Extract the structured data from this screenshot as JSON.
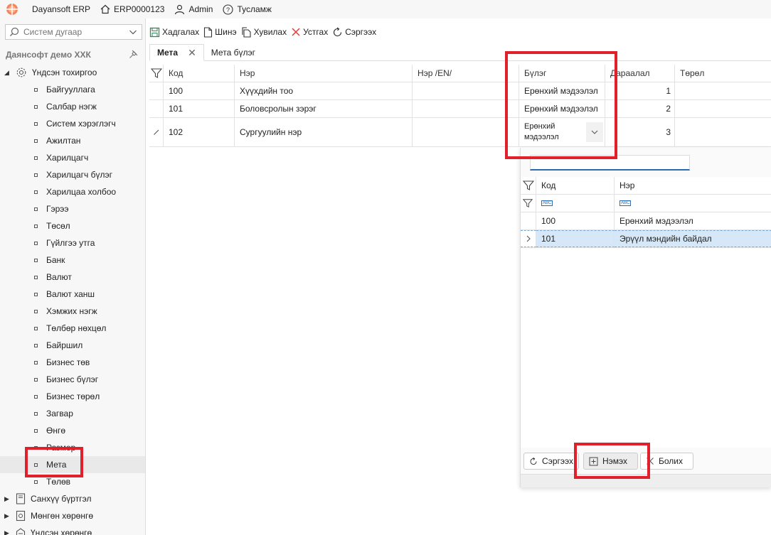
{
  "topbar": {
    "app_name": "Dayansoft ERP",
    "system_no": "ERP0000123",
    "user": "Admin",
    "help": "Тусламж"
  },
  "sidebar": {
    "search_placeholder": "Систем дугаар",
    "company": "Даянсофт демо ХХК",
    "root_setup": "Үндсэн тохиргоо",
    "items": [
      "Байгууллага",
      "Салбар нэгж",
      "Систем хэрэглэгч",
      "Ажилтан",
      "Харилцагч",
      "Харилцагч бүлэг",
      "Харилцаа холбоо",
      "Гэрээ",
      "Төсөл",
      "Гүйлгээ утга",
      "Банк",
      "Валют",
      "Валют ханш",
      "Хэмжих нэгж",
      "Төлбөр нөхцөл",
      "Байршил",
      "Бизнес төв",
      "Бизнес бүлэг",
      "Бизнес төрөл",
      "Загвар",
      "Өнгө",
      "Размер",
      "Мета",
      "Төлөв"
    ],
    "roots_bottom": [
      "Санхүү бүртгэл",
      "Мөнгөн хөрөнгө",
      "Үндсэн хөрөнгө"
    ]
  },
  "toolbar": {
    "save": "Хадгалах",
    "new": "Шинэ",
    "copy": "Хувилах",
    "delete": "Устгах",
    "refresh": "Сэргээх"
  },
  "tabs": [
    "Мета",
    "Мета бүлэг"
  ],
  "grid": {
    "headers": [
      "Код",
      "Нэр",
      "Нэр /EN/",
      "Бүлэг",
      "Дараалал",
      "Төрөл"
    ],
    "rows": [
      {
        "code": "100",
        "name": "Хүүхдийн тоо",
        "group": "Ерөнхий мэдээлэл",
        "order": "1"
      },
      {
        "code": "101",
        "name": "Боловсролын зэрэг",
        "group": "Ерөнхий мэдээлэл",
        "order": "2"
      },
      {
        "code": "102",
        "name": "Сургуулийн нэр",
        "group_line1": "Ерөнхий",
        "group_line2": "мэдээлэл",
        "order": "3"
      }
    ]
  },
  "popup": {
    "headers": [
      "Код",
      "Нэр"
    ],
    "filter_badge": "ABC",
    "rows": [
      {
        "code": "100",
        "name": "Ерөнхий мэдээлэл"
      },
      {
        "code": "101",
        "name": "Эрүүл мэндийн байдал"
      }
    ],
    "btn_refresh": "Сэргээх",
    "btn_add": "Нэмэх",
    "btn_cancel": "Болих"
  },
  "colors": {
    "highlight": "#e0202a",
    "selection": "#d6e8f7",
    "accent": "#2b6cb0",
    "save_icon": "#2e8b57",
    "delete_icon": "#e53935"
  }
}
